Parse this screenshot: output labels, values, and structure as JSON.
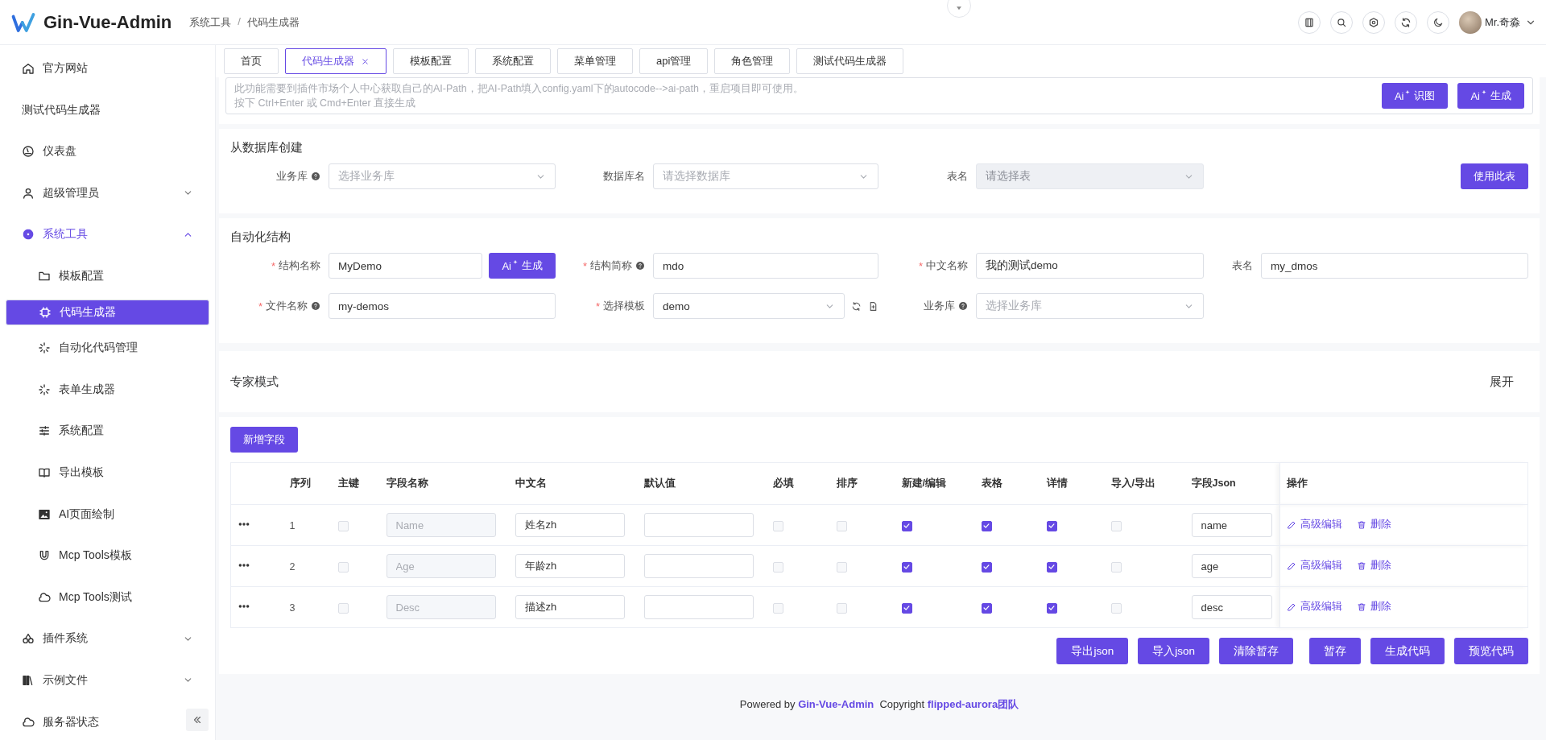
{
  "header": {
    "title": "Gin-Vue-Admin",
    "breadcrumb": [
      "系统工具",
      "代码生成器"
    ],
    "breadcrumb_separator": "/",
    "user": "Mr.奇淼"
  },
  "sidebar": {
    "items": [
      {
        "label": "官方网站",
        "selected": false
      },
      {
        "label": "测试代码生成器",
        "selected": false
      },
      {
        "label": "仪表盘",
        "selected": false
      },
      {
        "label": "超级管理员",
        "selected": false,
        "expanded": false
      },
      {
        "label": "系统工具",
        "selected": false,
        "expanded": true,
        "children": [
          {
            "label": "模板配置",
            "selected": false
          },
          {
            "label": "代码生成器",
            "selected": true
          },
          {
            "label": "自动化代码管理",
            "selected": false
          },
          {
            "label": "表单生成器",
            "selected": false
          },
          {
            "label": "系统配置",
            "selected": false
          },
          {
            "label": "导出模板",
            "selected": false
          },
          {
            "label": "AI页面绘制",
            "selected": false
          },
          {
            "label": "Mcp Tools模板",
            "selected": false
          },
          {
            "label": "Mcp Tools测试",
            "selected": false
          }
        ]
      },
      {
        "label": "插件系统",
        "selected": false,
        "expanded": false
      },
      {
        "label": "示例文件",
        "selected": false,
        "expanded": false
      },
      {
        "label": "服务器状态",
        "selected": false
      }
    ]
  },
  "tabs": [
    {
      "label": "首页",
      "selected": false,
      "closable": false
    },
    {
      "label": "代码生成器",
      "selected": true,
      "closable": true
    },
    {
      "label": "模板配置",
      "selected": false,
      "closable": false
    },
    {
      "label": "系统配置",
      "selected": false,
      "closable": false
    },
    {
      "label": "菜单管理",
      "selected": false,
      "closable": false
    },
    {
      "label": "api管理",
      "selected": false,
      "closable": false
    },
    {
      "label": "角色管理",
      "selected": false,
      "closable": false
    },
    {
      "label": "测试代码生成器",
      "selected": false,
      "closable": false
    }
  ],
  "ai_box": {
    "lines": [
      "此功能需要到插件市场个人中心获取自己的AI-Path，把AI-Path填入config.yaml下的autocode-->ai-path，重启项目即可使用。",
      "按下 Ctrl+Enter 或 Cmd+Enter 直接生成"
    ],
    "buttons": [
      {
        "prefix": "Ai",
        "label": "识图"
      },
      {
        "prefix": "Ai",
        "label": "生成"
      }
    ]
  },
  "from_db": {
    "title": "从数据库创建",
    "fields": [
      {
        "label": "业务库",
        "help": true,
        "placeholder": "选择业务库",
        "disabled": false
      },
      {
        "label": "数据库名",
        "help": false,
        "placeholder": "请选择数据库",
        "disabled": false
      },
      {
        "label": "表名",
        "help": false,
        "placeholder": "请选择表",
        "disabled": true
      }
    ],
    "button": "使用此表"
  },
  "auto_struct": {
    "title": "自动化结构",
    "required_mark": "*",
    "rows": [
      [
        {
          "kind": "input",
          "label": "结构名称",
          "required": true,
          "help": false,
          "value": "MyDemo",
          "ai_button": {
            "prefix": "Ai",
            "label": "生成"
          }
        },
        {
          "kind": "input",
          "label": "结构简称",
          "required": true,
          "help": true,
          "value": "mdo"
        },
        {
          "kind": "input",
          "label": "中文名称",
          "required": true,
          "help": false,
          "value": "我的测试demo"
        },
        {
          "kind": "input",
          "label": "表名",
          "required": false,
          "help": false,
          "value": "my_dmos"
        }
      ],
      [
        {
          "kind": "input",
          "label": "文件名称",
          "required": true,
          "help": true,
          "value": "my-demos"
        },
        {
          "kind": "select",
          "label": "选择模板",
          "required": true,
          "help": false,
          "value": "demo",
          "tools": true
        },
        {
          "kind": "select",
          "label": "业务库",
          "required": false,
          "help": true,
          "placeholder": "选择业务库"
        }
      ]
    ]
  },
  "expert": {
    "title": "专家模式",
    "toggle": "展开"
  },
  "add_button": "新增字段",
  "table": {
    "columns": [
      "序列",
      "主键",
      "字段名称",
      "中文名",
      "默认值",
      "必填",
      "排序",
      "新建/编辑",
      "表格",
      "详情",
      "导入/导出",
      "字段Json",
      "操作"
    ],
    "rows": [
      {
        "index": "1",
        "primary_key": false,
        "field_name": "Name",
        "cn_name": "姓名zh",
        "required": false,
        "sort": false,
        "form": true,
        "table": true,
        "desc": true,
        "excel": false,
        "json": "name",
        "actions": [
          "高级编辑",
          "删除"
        ]
      },
      {
        "index": "2",
        "primary_key": false,
        "field_name": "Age",
        "cn_name": "年龄zh",
        "required": false,
        "sort": false,
        "form": true,
        "table": true,
        "desc": true,
        "excel": false,
        "json": "age",
        "actions": [
          "高级编辑",
          "删除"
        ]
      },
      {
        "index": "3",
        "primary_key": false,
        "field_name": "Desc",
        "cn_name": "描述zh",
        "required": false,
        "sort": false,
        "form": true,
        "table": true,
        "desc": true,
        "excel": false,
        "json": "desc",
        "actions": [
          "高级编辑",
          "删除"
        ]
      }
    ]
  },
  "bottom_buttons": [
    "导出json",
    "导入json",
    "清除暂存",
    "暂存",
    "生成代码",
    "预览代码"
  ],
  "footer": {
    "parts": [
      {
        "text": "Powered by ",
        "link": false
      },
      {
        "text": "Gin-Vue-Admin",
        "link": true
      },
      {
        "text": "  Copyright ",
        "link": false
      },
      {
        "text": "flipped-aurora团队",
        "link": true
      }
    ]
  }
}
